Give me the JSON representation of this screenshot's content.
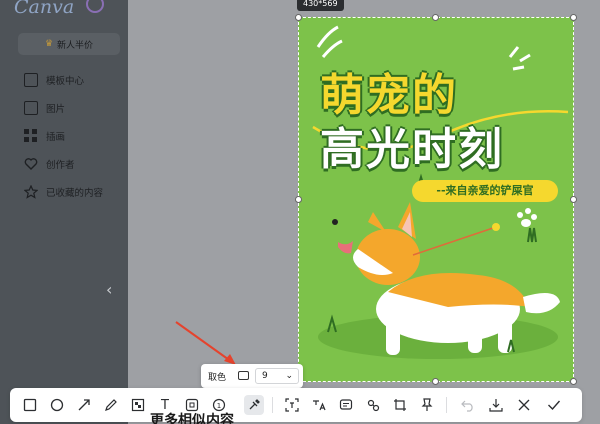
{
  "app": {
    "brand": "Canva"
  },
  "sidebar": {
    "promo_label": "新人半价",
    "items": [
      {
        "label": "模板中心",
        "icon": "template-icon"
      },
      {
        "label": "图片",
        "icon": "image-icon"
      },
      {
        "label": "插画",
        "icon": "illustration-icon"
      },
      {
        "label": "创作者",
        "icon": "creator-icon"
      },
      {
        "label": "已收藏的内容",
        "icon": "star-icon"
      }
    ],
    "collapse_icon": "chevron-left-icon"
  },
  "canvas": {
    "size_label": "430*569",
    "poster": {
      "title_line1": "萌宠的",
      "title_line2": "高光时刻",
      "subtitle": "--来自亲爱的铲屎官"
    }
  },
  "color_picker": {
    "label": "取色",
    "format_icon": "color-format-icon",
    "value": "9"
  },
  "toolbar": {
    "tools": [
      "rectangle-icon",
      "ellipse-icon",
      "arrow-icon",
      "pen-icon",
      "mosaic-icon",
      "text-icon",
      "number-icon",
      "counter-icon",
      "eyedropper-icon",
      "ocr-icon",
      "translate-icon",
      "summarize-icon",
      "recognize-icon",
      "crop-icon",
      "pin-icon",
      "undo-icon",
      "download-icon",
      "close-icon",
      "confirm-icon"
    ],
    "text_tool_glyph": "T",
    "counter_glyph": "1"
  },
  "bottom_heading": "更多相似内容",
  "colors": {
    "poster_bg": "#7dc24a",
    "title_yellow": "#f5d82e",
    "title_outline": "#2f6d22",
    "overlay": "#4e5358"
  }
}
